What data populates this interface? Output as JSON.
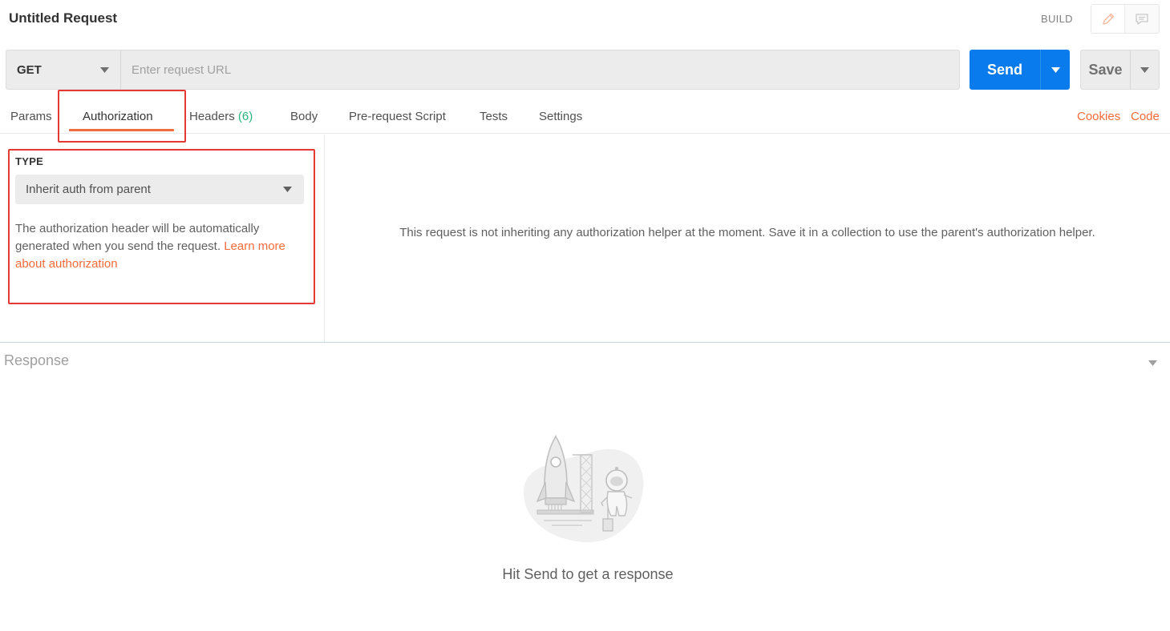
{
  "header": {
    "title": "Untitled Request",
    "mode_label": "BUILD",
    "mode_icons": [
      "pencil-icon",
      "comment-icon"
    ]
  },
  "request": {
    "method": "GET",
    "url_value": "",
    "url_placeholder": "Enter request URL",
    "send_label": "Send",
    "save_label": "Save"
  },
  "tabs": {
    "items": [
      {
        "label": "Params"
      },
      {
        "label": "Authorization",
        "active": true
      },
      {
        "label": "Headers",
        "count": "(6)"
      },
      {
        "label": "Body"
      },
      {
        "label": "Pre-request Script"
      },
      {
        "label": "Tests"
      },
      {
        "label": "Settings"
      }
    ],
    "right_links": [
      "Cookies",
      "Code"
    ]
  },
  "auth": {
    "type_label": "TYPE",
    "type_value": "Inherit auth from parent",
    "description": "The authorization header will be automatically generated when you send the request. ",
    "learn_more": "Learn more about authorization",
    "note": "This request is not inheriting any authorization helper at the moment. Save it in a collection to use the parent's authorization helper."
  },
  "response": {
    "label": "Response",
    "hint": "Hit Send to get a response"
  },
  "colors": {
    "accent": "#f26b3a",
    "send_blue": "#097bed",
    "highlight_red": "#e53935",
    "count_green": "#26b47f"
  }
}
